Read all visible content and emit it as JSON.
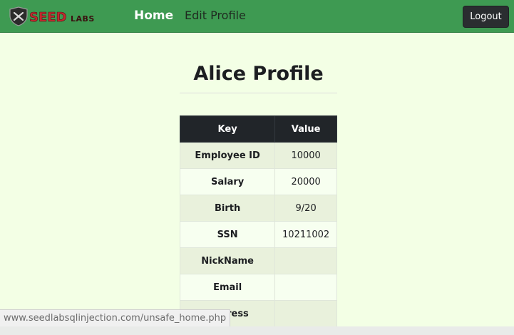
{
  "navbar": {
    "logo_text": "SEEDLABS",
    "home_label": "Home",
    "edit_profile_label": "Edit Profile",
    "logout_label": "Logout",
    "background_color": "#3e9a52"
  },
  "profile": {
    "title": "Alice Profile"
  },
  "table": {
    "headers": [
      "Key",
      "Value"
    ],
    "rows": [
      {
        "key": "Employee ID",
        "value": "10000"
      },
      {
        "key": "Salary",
        "value": "20000"
      },
      {
        "key": "Birth",
        "value": "9/20"
      },
      {
        "key": "SSN",
        "value": "10211002"
      },
      {
        "key": "NickName",
        "value": ""
      },
      {
        "key": "Email",
        "value": ""
      },
      {
        "key": "Address",
        "value": ""
      }
    ]
  },
  "status_bar": {
    "url": "www.seedlabsqlinjection.com/unsafe_home.php"
  }
}
